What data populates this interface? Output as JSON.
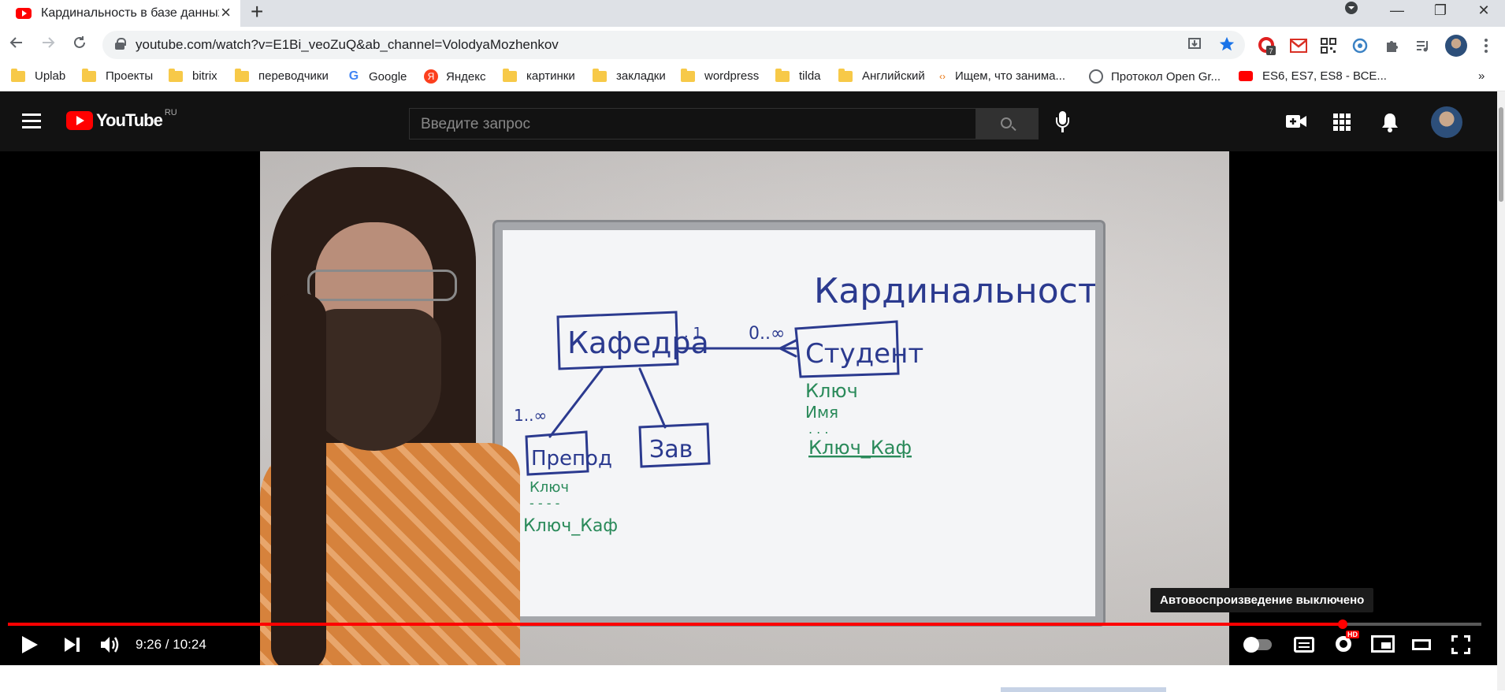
{
  "browser": {
    "tab_title": "Кардинальность в базе данных",
    "url": "youtube.com/watch?v=E1Bi_veoZuQ&ab_channel=VolodyaMozhenkov",
    "extension_badge": "7",
    "bookmarks": [
      {
        "label": "Uplab",
        "icon": "folder-icon"
      },
      {
        "label": "Проекты",
        "icon": "folder-icon"
      },
      {
        "label": "bitrix",
        "icon": "folder-icon"
      },
      {
        "label": "переводчики",
        "icon": "folder-icon"
      },
      {
        "label": "Google",
        "icon": "google-icon"
      },
      {
        "label": "Яндекс",
        "icon": "yandex-icon"
      },
      {
        "label": "картинки",
        "icon": "folder-icon"
      },
      {
        "label": "закладки",
        "icon": "folder-icon"
      },
      {
        "label": "wordpress",
        "icon": "folder-icon"
      },
      {
        "label": "tilda",
        "icon": "folder-icon"
      },
      {
        "label": "Английский",
        "icon": "folder-icon"
      },
      {
        "label": "Ищем, что занима...",
        "icon": "site-icon"
      },
      {
        "label": "Протокол Open Gr...",
        "icon": "globe-icon"
      },
      {
        "label": "ES6, ES7, ES8 - ВСЕ...",
        "icon": "youtube-icon"
      }
    ],
    "more_bookmarks": "»"
  },
  "youtube": {
    "logo_text": "YouTube",
    "logo_region": "RU",
    "search_placeholder": "Введите запрос"
  },
  "player": {
    "current_time": "9:26",
    "duration": "10:24",
    "time_display": "9:26 / 10:24",
    "progress": 0.906,
    "autoplay_tooltip": "Автовоспроизведение выключено",
    "hd_badge": "HD"
  },
  "colors": {
    "youtube_red": "#ff0000",
    "chrome_tabstrip": "#dee1e6",
    "marker_blue": "#2b3a8f",
    "marker_green": "#2a8a5a"
  }
}
